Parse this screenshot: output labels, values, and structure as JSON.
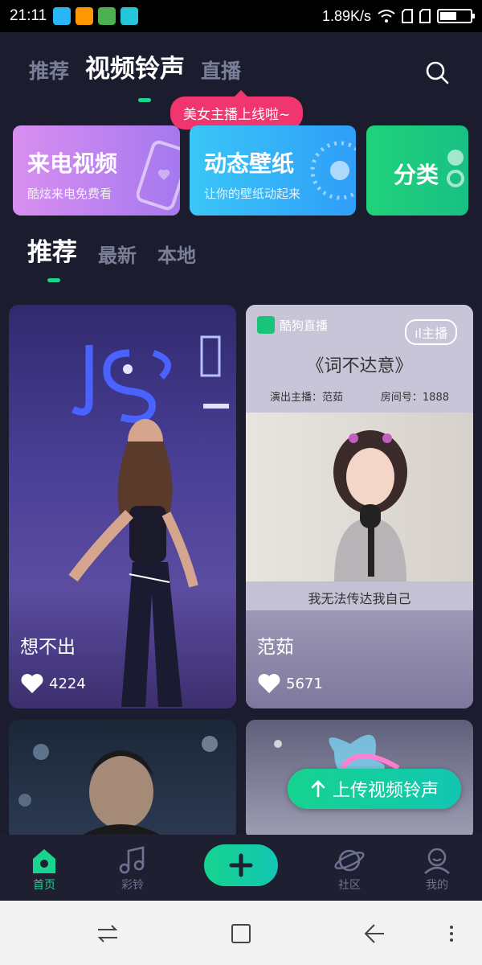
{
  "status_bar": {
    "time": "21:11",
    "network_speed": "1.89K/s",
    "battery_level": 0.55
  },
  "top_tabs": [
    {
      "label": "推荐",
      "active": false
    },
    {
      "label": "视频铃声",
      "active": true
    },
    {
      "label": "直播",
      "active": false
    }
  ],
  "tooltip": "美女主播上线啦~",
  "features": [
    {
      "title": "来电视频",
      "subtitle": "酷炫来电免费看"
    },
    {
      "title": "动态壁纸",
      "subtitle": "让你的壁纸动起来"
    },
    {
      "title": "分类"
    }
  ],
  "sub_tabs": [
    {
      "label": "推荐",
      "active": true
    },
    {
      "label": "最新",
      "active": false
    },
    {
      "label": "本地",
      "active": false
    }
  ],
  "videos": [
    {
      "name": "想不出",
      "likes": "4224"
    },
    {
      "name": "范茹",
      "likes": "5671",
      "brand": "酷狗直播",
      "live_badge": "主播",
      "song": "《词不达意》",
      "singer": "演出主播：范茹",
      "room": "房间号：1888",
      "caption": "我无法传达我自己"
    }
  ],
  "upload_button": "上传视频铃声",
  "bottom_nav": [
    {
      "label": "首页",
      "active": true
    },
    {
      "label": "彩铃",
      "active": false
    },
    {
      "label": "社区",
      "active": false
    },
    {
      "label": "我的",
      "active": false
    }
  ],
  "colors": {
    "accent": "#19d38e",
    "background": "#1b1d2e",
    "tooltip": "#f0356f"
  }
}
